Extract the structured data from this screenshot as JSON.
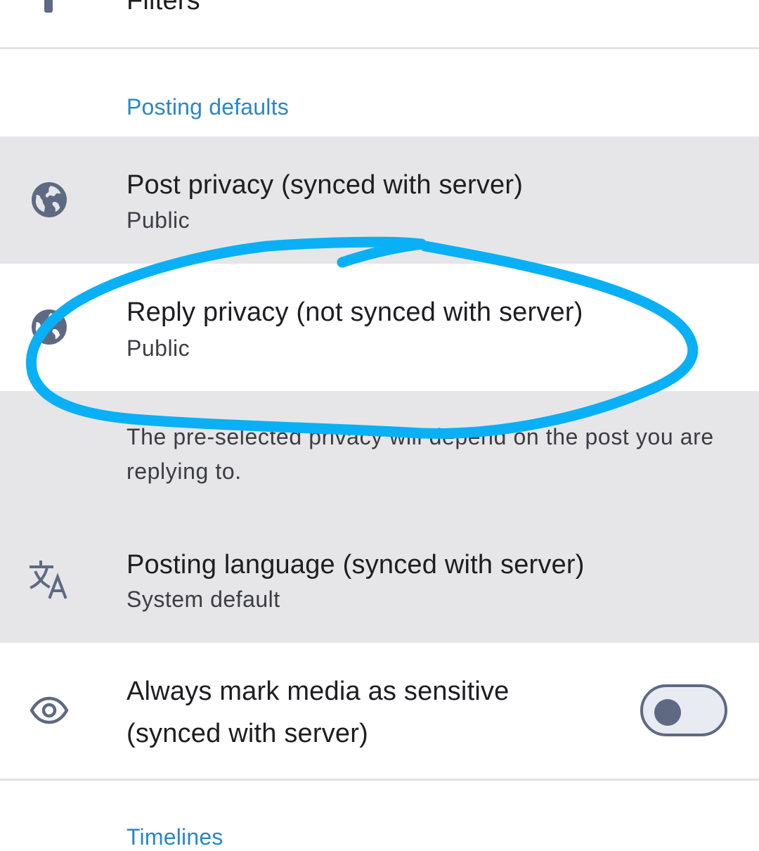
{
  "filters": {
    "label": "Filters",
    "icon": "filter-icon"
  },
  "posting_defaults": {
    "header": "Posting defaults",
    "post_privacy": {
      "title": "Post privacy (synced with server)",
      "value": "Public",
      "icon": "globe-icon"
    },
    "reply_privacy": {
      "title": "Reply privacy (not synced with server)",
      "value": "Public",
      "icon": "globe-icon",
      "hint": "The pre-selected privacy will depend on the post you are replying to."
    },
    "posting_language": {
      "title": "Posting language (synced with server)",
      "value": "System default",
      "icon": "translate-icon"
    },
    "sensitive_media": {
      "title_line1": "Always mark media as sensitive",
      "title_line2": "(synced with server)",
      "icon": "eye-icon",
      "toggle_on": false
    }
  },
  "timelines": {
    "header": "Timelines"
  },
  "colors": {
    "accent": "#2b86c5",
    "icon": "#5e6a82",
    "annotation": "#0ab0f5"
  }
}
